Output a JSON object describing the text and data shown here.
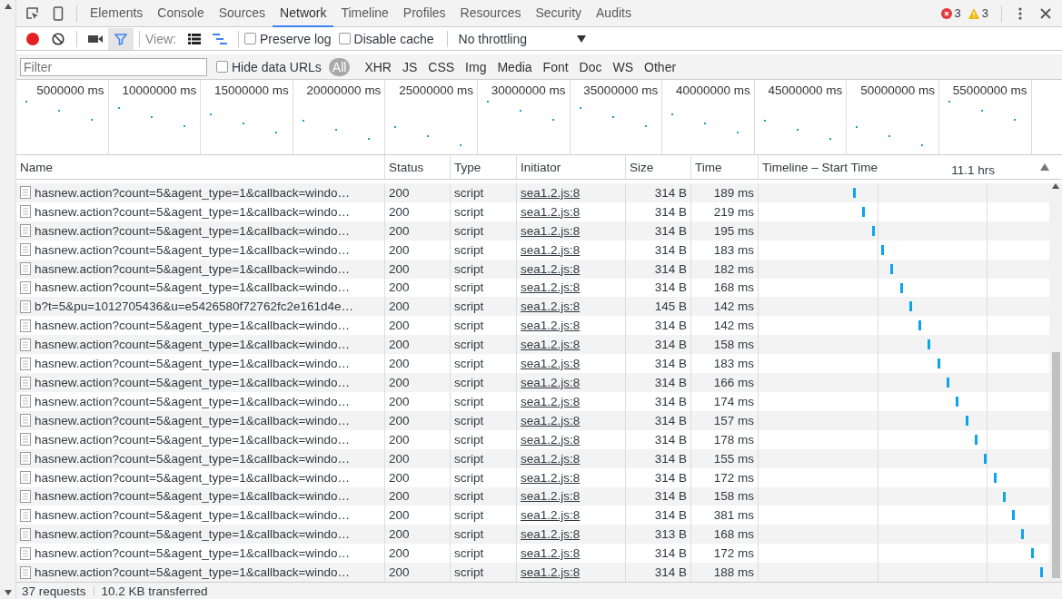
{
  "tabs": [
    {
      "label": "Elements",
      "selected": false
    },
    {
      "label": "Console",
      "selected": false
    },
    {
      "label": "Sources",
      "selected": false
    },
    {
      "label": "Network",
      "selected": true
    },
    {
      "label": "Timeline",
      "selected": false
    },
    {
      "label": "Profiles",
      "selected": false
    },
    {
      "label": "Resources",
      "selected": false
    },
    {
      "label": "Security",
      "selected": false
    },
    {
      "label": "Audits",
      "selected": false
    }
  ],
  "counts": {
    "errors": "3",
    "warnings": "3"
  },
  "toolbar": {
    "recording": true,
    "filter_active": true,
    "view_label": "View:",
    "checkboxes": [
      {
        "label": "Preserve log",
        "checked": false
      },
      {
        "label": "Disable cache",
        "checked": false
      }
    ],
    "throttling": "No throttling"
  },
  "filter_bar": {
    "placeholder": "Filter",
    "hide_data_urls": {
      "label": "Hide data URLs",
      "checked": false
    },
    "types": [
      {
        "label": "All",
        "selected": true
      },
      {
        "label": "XHR",
        "selected": false
      },
      {
        "label": "JS",
        "selected": false
      },
      {
        "label": "CSS",
        "selected": false
      },
      {
        "label": "Img",
        "selected": false
      },
      {
        "label": "Media",
        "selected": false
      },
      {
        "label": "Font",
        "selected": false
      },
      {
        "label": "Doc",
        "selected": false
      },
      {
        "label": "WS",
        "selected": false
      },
      {
        "label": "Other",
        "selected": false
      }
    ]
  },
  "overview": {
    "ticks": [
      "5000000 ms",
      "10000000 ms",
      "15000000 ms",
      "20000000 ms",
      "25000000 ms",
      "30000000 ms",
      "35000000 ms",
      "40000000 ms",
      "45000000 ms",
      "50000000 ms",
      "55000000 ms"
    ]
  },
  "table": {
    "columns": [
      "Name",
      "Status",
      "Type",
      "Initiator",
      "Size",
      "Time",
      "Timeline – Start Time"
    ],
    "timeline_scale": "11.1 hrs",
    "rows": [
      {
        "name": "hasnew.action?count=5&agent_type=1&callback=windo…",
        "status": "200",
        "type": "script",
        "initiator": "sea1.2.js:8",
        "size": "314 B",
        "time": "189 ms"
      },
      {
        "name": "hasnew.action?count=5&agent_type=1&callback=windo…",
        "status": "200",
        "type": "script",
        "initiator": "sea1.2.js:8",
        "size": "314 B",
        "time": "219 ms"
      },
      {
        "name": "hasnew.action?count=5&agent_type=1&callback=windo…",
        "status": "200",
        "type": "script",
        "initiator": "sea1.2.js:8",
        "size": "314 B",
        "time": "195 ms"
      },
      {
        "name": "hasnew.action?count=5&agent_type=1&callback=windo…",
        "status": "200",
        "type": "script",
        "initiator": "sea1.2.js:8",
        "size": "314 B",
        "time": "183 ms"
      },
      {
        "name": "hasnew.action?count=5&agent_type=1&callback=windo…",
        "status": "200",
        "type": "script",
        "initiator": "sea1.2.js:8",
        "size": "314 B",
        "time": "182 ms"
      },
      {
        "name": "hasnew.action?count=5&agent_type=1&callback=windo…",
        "status": "200",
        "type": "script",
        "initiator": "sea1.2.js:8",
        "size": "314 B",
        "time": "168 ms"
      },
      {
        "name": "b?t=5&pu=1012705436&u=e5426580f72762fc2e161d4e…",
        "status": "200",
        "type": "script",
        "initiator": "sea1.2.js:8",
        "size": "145 B",
        "time": "142 ms"
      },
      {
        "name": "hasnew.action?count=5&agent_type=1&callback=windo…",
        "status": "200",
        "type": "script",
        "initiator": "sea1.2.js:8",
        "size": "314 B",
        "time": "142 ms"
      },
      {
        "name": "hasnew.action?count=5&agent_type=1&callback=windo…",
        "status": "200",
        "type": "script",
        "initiator": "sea1.2.js:8",
        "size": "314 B",
        "time": "158 ms"
      },
      {
        "name": "hasnew.action?count=5&agent_type=1&callback=windo…",
        "status": "200",
        "type": "script",
        "initiator": "sea1.2.js:8",
        "size": "314 B",
        "time": "183 ms"
      },
      {
        "name": "hasnew.action?count=5&agent_type=1&callback=windo…",
        "status": "200",
        "type": "script",
        "initiator": "sea1.2.js:8",
        "size": "314 B",
        "time": "166 ms"
      },
      {
        "name": "hasnew.action?count=5&agent_type=1&callback=windo…",
        "status": "200",
        "type": "script",
        "initiator": "sea1.2.js:8",
        "size": "314 B",
        "time": "174 ms"
      },
      {
        "name": "hasnew.action?count=5&agent_type=1&callback=windo…",
        "status": "200",
        "type": "script",
        "initiator": "sea1.2.js:8",
        "size": "314 B",
        "time": "157 ms"
      },
      {
        "name": "hasnew.action?count=5&agent_type=1&callback=windo…",
        "status": "200",
        "type": "script",
        "initiator": "sea1.2.js:8",
        "size": "314 B",
        "time": "178 ms"
      },
      {
        "name": "hasnew.action?count=5&agent_type=1&callback=windo…",
        "status": "200",
        "type": "script",
        "initiator": "sea1.2.js:8",
        "size": "314 B",
        "time": "155 ms"
      },
      {
        "name": "hasnew.action?count=5&agent_type=1&callback=windo…",
        "status": "200",
        "type": "script",
        "initiator": "sea1.2.js:8",
        "size": "314 B",
        "time": "172 ms"
      },
      {
        "name": "hasnew.action?count=5&agent_type=1&callback=windo…",
        "status": "200",
        "type": "script",
        "initiator": "sea1.2.js:8",
        "size": "314 B",
        "time": "158 ms"
      },
      {
        "name": "hasnew.action?count=5&agent_type=1&callback=windo…",
        "status": "200",
        "type": "script",
        "initiator": "sea1.2.js:8",
        "size": "314 B",
        "time": "381 ms"
      },
      {
        "name": "hasnew.action?count=5&agent_type=1&callback=windo…",
        "status": "200",
        "type": "script",
        "initiator": "sea1.2.js:8",
        "size": "313 B",
        "time": "168 ms"
      },
      {
        "name": "hasnew.action?count=5&agent_type=1&callback=windo…",
        "status": "200",
        "type": "script",
        "initiator": "sea1.2.js:8",
        "size": "314 B",
        "time": "172 ms"
      },
      {
        "name": "hasnew.action?count=5&agent_type=1&callback=windo…",
        "status": "200",
        "type": "script",
        "initiator": "sea1.2.js:8",
        "size": "314 B",
        "time": "188 ms"
      }
    ]
  },
  "status_bar": {
    "requests": "37 requests",
    "transferred": "10.2 KB transferred"
  }
}
